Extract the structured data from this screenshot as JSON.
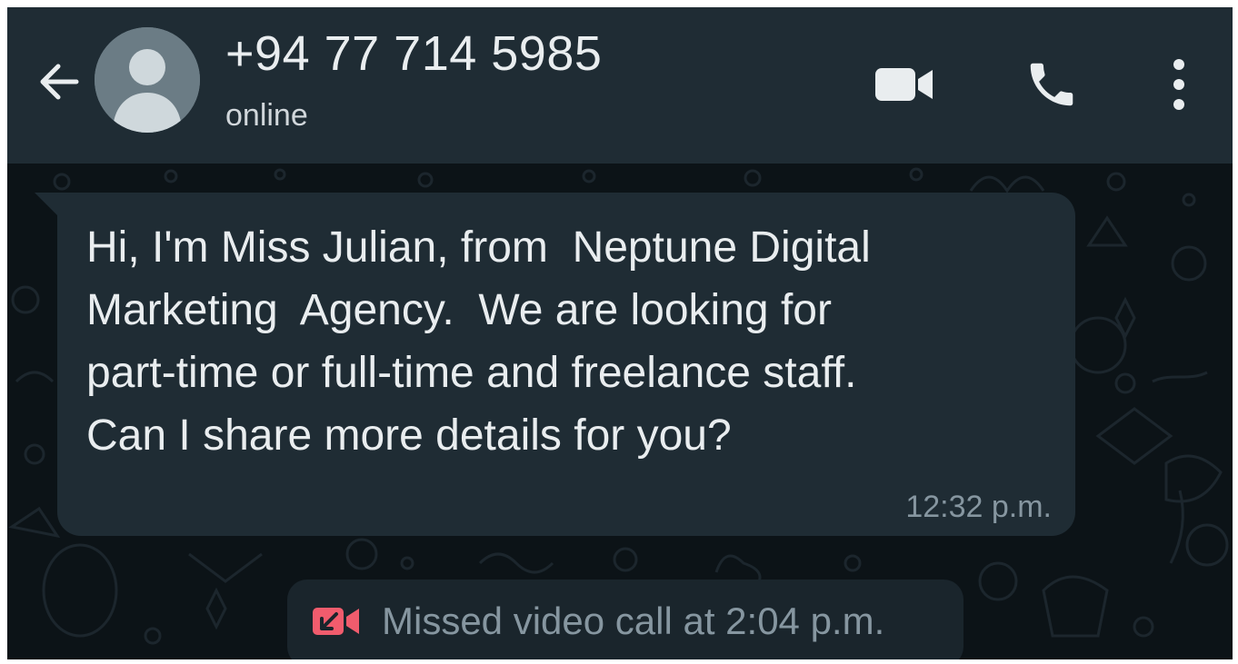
{
  "header": {
    "contact_name": "+94 77 714 5985",
    "status": "online",
    "icons": {
      "back": "arrow-left-icon",
      "avatar": "default-user-avatar",
      "video": "video-camera-icon",
      "call": "phone-icon",
      "menu": "more-vertical-icon"
    }
  },
  "messages": [
    {
      "text": "Hi, I'm Miss Julian, from  Neptune Digital\nMarketing  Agency.  We are looking for\npart-time or full-time and freelance staff.\nCan I share more details for you?",
      "time": "12:32 p.m.",
      "direction": "incoming"
    }
  ],
  "system_message": {
    "icon": "missed-video-call-icon",
    "text": "Missed video call at 2:04 p.m."
  },
  "colors": {
    "header_bg": "#1f2c34",
    "chat_bg": "#0c1317",
    "bubble_bg": "#1f2c34",
    "text_primary": "#e9edef",
    "text_secondary": "#8696a0",
    "missed_call_red": "#f15c6d"
  }
}
